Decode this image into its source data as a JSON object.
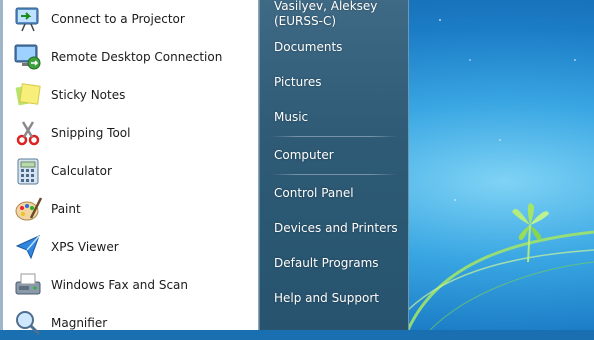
{
  "programs": [
    {
      "label": "Connect to a Projector",
      "icon": "projector-icon"
    },
    {
      "label": "Remote Desktop Connection",
      "icon": "remote-desktop-icon"
    },
    {
      "label": "Sticky Notes",
      "icon": "sticky-notes-icon"
    },
    {
      "label": "Snipping Tool",
      "icon": "snipping-tool-icon"
    },
    {
      "label": "Calculator",
      "icon": "calculator-icon"
    },
    {
      "label": "Paint",
      "icon": "paint-icon"
    },
    {
      "label": "XPS Viewer",
      "icon": "xps-viewer-icon"
    },
    {
      "label": "Windows Fax and Scan",
      "icon": "fax-scan-icon"
    },
    {
      "label": "Magnifier",
      "icon": "magnifier-icon"
    }
  ],
  "user": {
    "name_line1": "Vasilyev, Aleksey",
    "name_line2": "(EURSS-C)"
  },
  "places": {
    "documents": "Documents",
    "pictures": "Pictures",
    "music": "Music",
    "computer": "Computer",
    "control_panel": "Control Panel",
    "devices_printers": "Devices and Printers",
    "default_programs": "Default Programs",
    "help_support": "Help and Support"
  },
  "colors": {
    "right_pane": "#2f5b77",
    "desktop": "#1b7cc6"
  }
}
